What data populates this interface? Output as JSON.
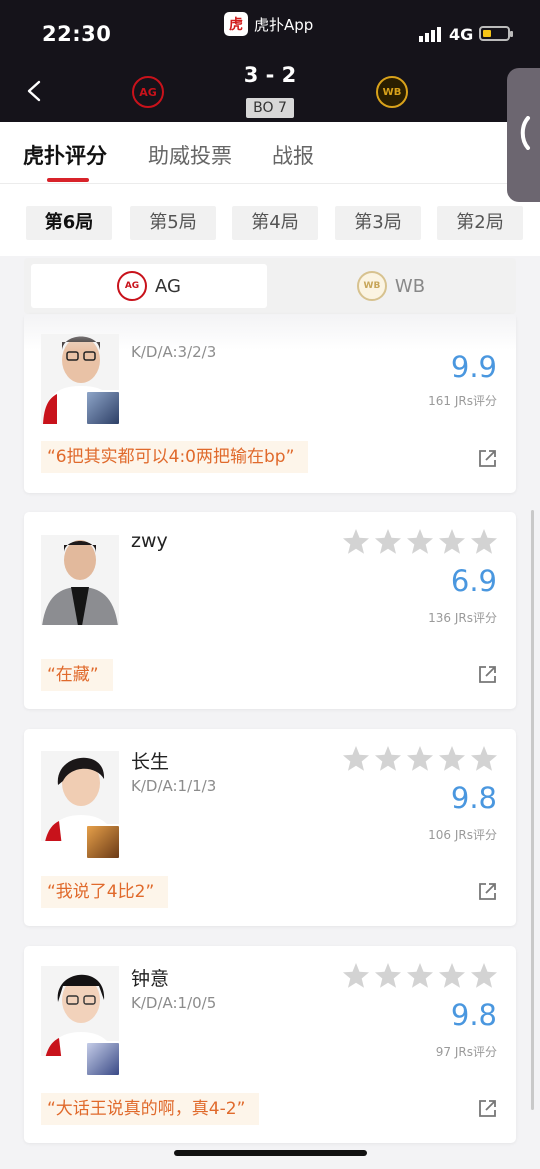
{
  "status_bar": {
    "time": "22:30",
    "app_name": "虎扑App",
    "network": "4G",
    "battery_color": "#f5c518"
  },
  "match": {
    "score": "3 - 2",
    "format": "BO 7",
    "home_team": "AG",
    "away_team": "WB"
  },
  "tabs": [
    {
      "label": "虎扑评分",
      "active": true
    },
    {
      "label": "助威投票",
      "active": false
    },
    {
      "label": "战报",
      "active": false
    }
  ],
  "games": [
    {
      "label": "第6局",
      "active": true
    },
    {
      "label": "第5局",
      "active": false
    },
    {
      "label": "第4局",
      "active": false
    },
    {
      "label": "第3局",
      "active": false
    },
    {
      "label": "第2局",
      "active": false
    }
  ],
  "team_selector": [
    {
      "label": "AG",
      "active": true
    },
    {
      "label": "WB",
      "active": false
    }
  ],
  "players": [
    {
      "name": "",
      "kda": "K/D/A:3/2/3",
      "rating": "9.9",
      "votes": "161 JRs评分",
      "quote": "“6把其实都可以4:0两把输在bp”"
    },
    {
      "name": "zwy",
      "kda": "",
      "rating": "6.9",
      "votes": "136 JRs评分",
      "quote": "“在藏”"
    },
    {
      "name": "长生",
      "kda": "K/D/A:1/1/3",
      "rating": "9.8",
      "votes": "106 JRs评分",
      "quote": "“我说了4比2”"
    },
    {
      "name": "钟意",
      "kda": "K/D/A:1/0/5",
      "rating": "9.8",
      "votes": "97 JRs评分",
      "quote": "“大话王说真的啊，真4-2”"
    }
  ],
  "colors": {
    "accent_red": "#d8232a",
    "rating_blue": "#4a97df",
    "quote_orange": "#e06a2c"
  },
  "icons": {
    "back": "chevron-left-icon",
    "share": "share-out-icon",
    "star": "star-icon"
  }
}
